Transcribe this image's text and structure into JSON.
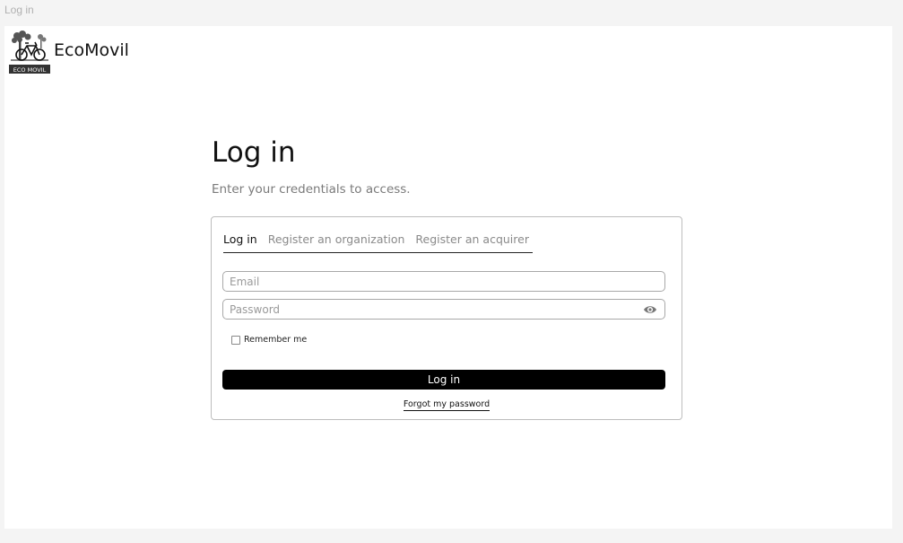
{
  "window": {
    "tab_title": "Log in"
  },
  "brand": {
    "name": "EcoMovil",
    "logo_text": "ECO MOVIL",
    "logo_icon": "bicycle-tree-logo"
  },
  "main": {
    "title": "Log in",
    "subtitle": "Enter your credentials to access."
  },
  "tabs": [
    {
      "label": "Log in",
      "active": true
    },
    {
      "label": "Register an organization",
      "active": false
    },
    {
      "label": "Register an acquirer",
      "active": false
    }
  ],
  "form": {
    "email_placeholder": "Email",
    "password_placeholder": "Password",
    "password_toggle_icon": "eye-icon",
    "remember_label": "Remember me",
    "submit_label": "Log in",
    "forgot_label": "Forgot my password"
  },
  "colors": {
    "primary_button": "#000000",
    "page_background": "#f4f4f4",
    "card_border": "#bdbdbd",
    "muted_text": "#8a8a8a"
  }
}
